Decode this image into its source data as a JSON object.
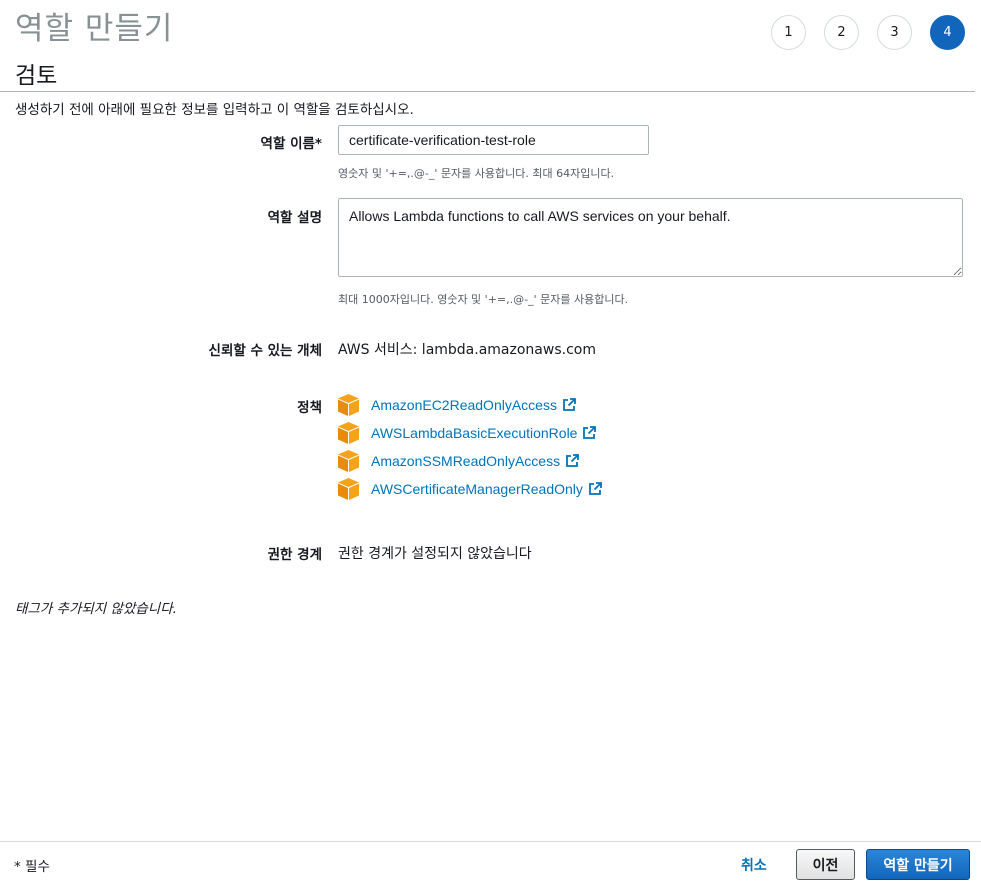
{
  "page": {
    "title": "역할 만들기",
    "steps": [
      "1",
      "2",
      "3",
      "4"
    ],
    "active_step": "4"
  },
  "review": {
    "section_title": "검토",
    "description": "생성하기 전에 아래에 필요한 정보를 입력하고 이 역할을 검토하십시오."
  },
  "form": {
    "role_name_label": "역할 이름*",
    "role_name_value": "certificate-verification-test-role",
    "role_name_hint": "영숫자 및 '+=,.@-_' 문자를 사용합니다. 최대 64자입니다.",
    "role_desc_label": "역할 설명",
    "role_desc_value": "Allows Lambda functions to call AWS services on your behalf.",
    "role_desc_hint": "최대 1000자입니다. 영숫자 및 '+=,.@-_' 문자를 사용합니다.",
    "trusted_label": "신뢰할 수 있는 개체",
    "trusted_value": "AWS 서비스: lambda.amazonaws.com",
    "policies_label": "정책",
    "policies": [
      {
        "name": "AmazonEC2ReadOnlyAccess",
        "icon": "aws-policy-cube-icon"
      },
      {
        "name": "AWSLambdaBasicExecutionRole",
        "icon": "aws-policy-cube-icon"
      },
      {
        "name": "AmazonSSMReadOnlyAccess",
        "icon": "aws-policy-cube-icon"
      },
      {
        "name": "AWSCertificateManagerReadOnly",
        "icon": "aws-policy-cube-icon"
      }
    ],
    "boundary_label": "권한 경계",
    "boundary_value": "권한 경계가 설정되지 않았습니다"
  },
  "tags_note": "태그가 추가되지 않았습니다.",
  "footer": {
    "required_note": "* 필수",
    "cancel_label": "취소",
    "previous_label": "이전",
    "create_label": "역할 만들기"
  },
  "colors": {
    "accent": "#1166bb",
    "link": "#0073bb",
    "policy_icon": "#f7a21b"
  }
}
